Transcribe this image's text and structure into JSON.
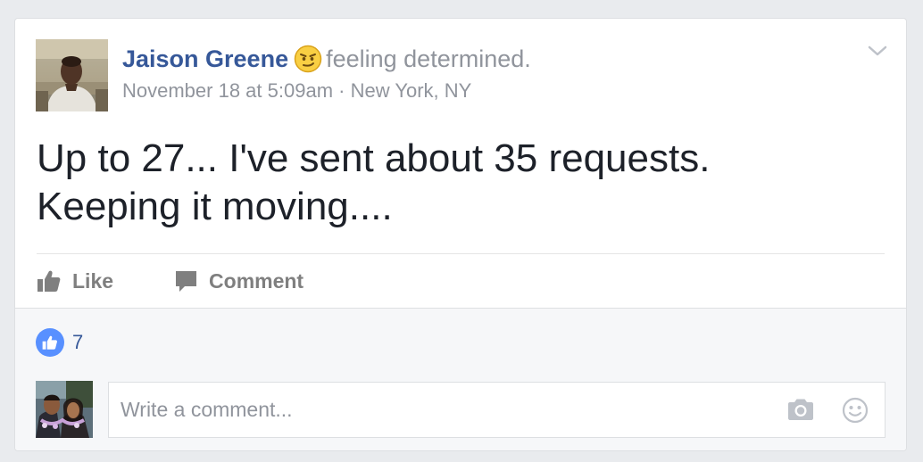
{
  "post": {
    "author": "Jaison Greene",
    "feeling_text": "feeling determined.",
    "feeling_icon": "determined-emoji-icon",
    "date": "November 18 at 5:09am",
    "separator": "·",
    "location": "New York, NY",
    "text_line1": "Up to 27... I've sent about 35 requests.",
    "text_line2": "Keeping it moving...."
  },
  "actions": {
    "like_label": "Like",
    "comment_label": "Comment"
  },
  "reactions": {
    "like_count": "7"
  },
  "comment_input": {
    "placeholder": "Write a comment..."
  },
  "icons": {
    "options": "chevron-down-icon",
    "like": "thumbs-up-icon",
    "comment": "speech-bubble-icon",
    "camera": "camera-icon",
    "emoji": "smiley-icon"
  },
  "colors": {
    "link": "#365899",
    "muted": "#90949c",
    "text": "#1d2129",
    "like_badge": "#5890ff",
    "background": "#e9ebee"
  }
}
